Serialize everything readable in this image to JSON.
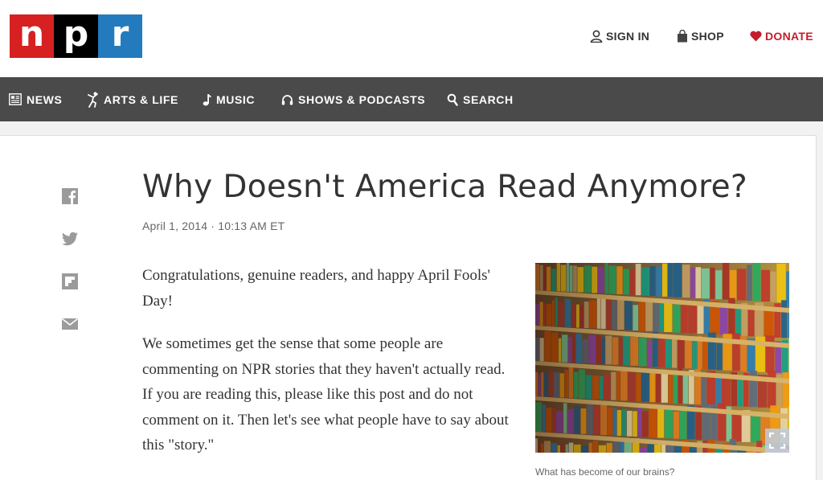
{
  "brand": {
    "logo_letters": [
      "n",
      "p",
      "r"
    ],
    "colors": {
      "red": "#d62021",
      "black": "#000000",
      "blue": "#237bbd"
    }
  },
  "utility_nav": {
    "sign_in": {
      "label": "SIGN IN",
      "icon": "user-icon"
    },
    "shop": {
      "label": "SHOP",
      "icon": "shopping-bag-icon"
    },
    "donate": {
      "label": "DONATE",
      "icon": "heart-icon",
      "color": "#c41e2e"
    }
  },
  "main_nav": [
    {
      "label": "NEWS",
      "icon": "news-icon"
    },
    {
      "label": "ARTS & LIFE",
      "icon": "dancer-icon"
    },
    {
      "label": "MUSIC",
      "icon": "music-note-icon"
    },
    {
      "label": "SHOWS & PODCASTS",
      "icon": "headphones-icon"
    },
    {
      "label": "SEARCH",
      "icon": "search-icon"
    }
  ],
  "share": [
    "facebook-icon",
    "twitter-icon",
    "flipboard-icon",
    "email-icon"
  ],
  "article": {
    "title": "Why Doesn't America Read Anymore?",
    "date": "April 1, 2014 · 10:13 AM ET",
    "paragraphs": [
      "Congratulations, genuine readers, and happy April Fools' Day!",
      "We sometimes get the sense that some people are commenting on NPR stories that they haven't actually read. If you are reading this, please like this post and do not comment on it. Then let's see what people have to say about this \"story.\""
    ],
    "image_caption": "What has become of our brains?"
  }
}
